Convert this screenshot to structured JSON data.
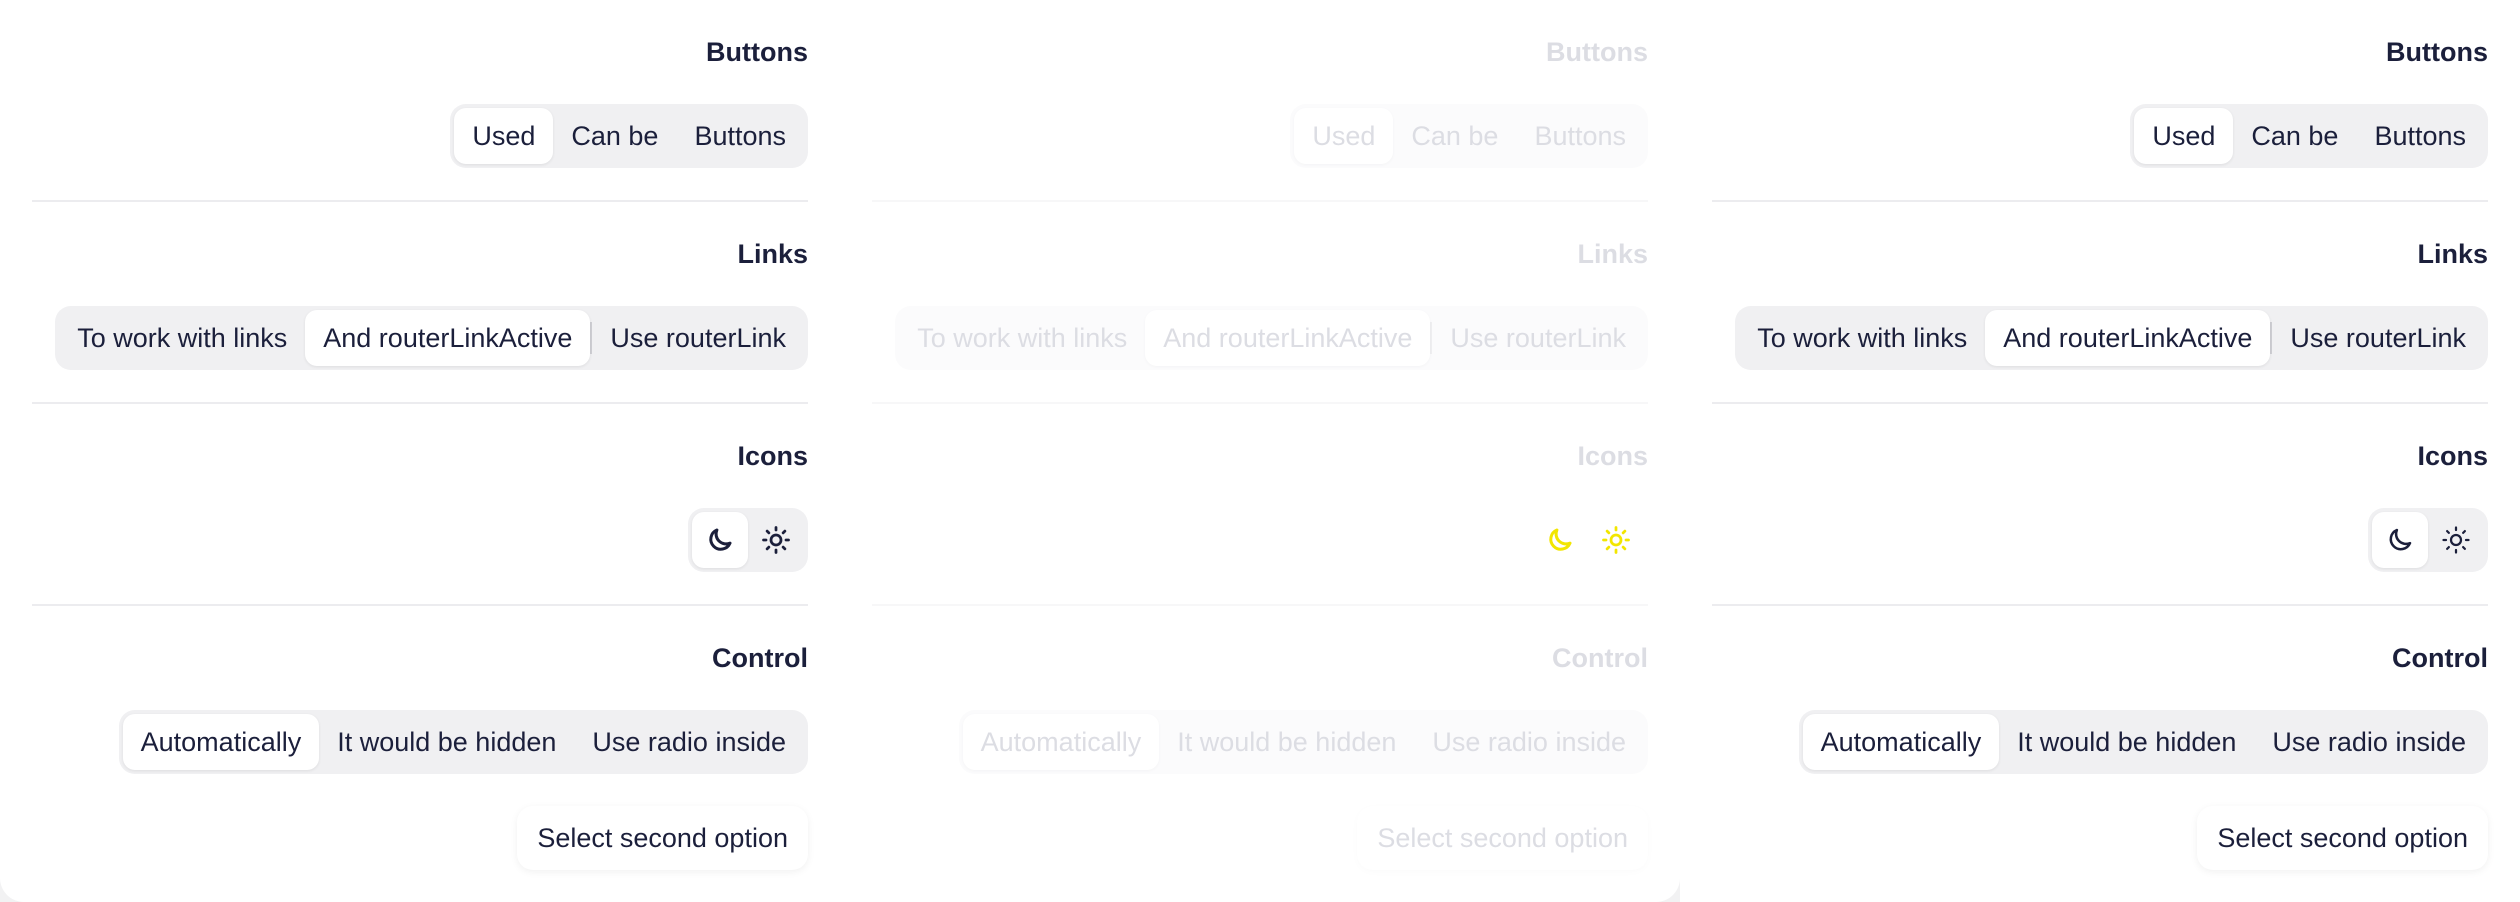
{
  "sections": {
    "buttons": {
      "title": "Buttons",
      "options": [
        "Used",
        "Can be",
        "Buttons"
      ]
    },
    "links": {
      "title": "Links",
      "options": [
        "To work with links",
        "And routerLinkActive",
        "Use routerLink"
      ]
    },
    "icons": {
      "title": "Icons",
      "options": [
        "moon-icon",
        "sun-icon"
      ]
    },
    "control": {
      "title": "Control",
      "options": [
        "Automatically",
        "It would be hidden",
        "Use radio inside"
      ],
      "select_button": "Select second option"
    }
  },
  "colors": {
    "text": "#1b1f3b",
    "faded_text": "#dcdde3",
    "faded_icon": "#f2e600",
    "segment_bg": "#f0f0f2"
  }
}
